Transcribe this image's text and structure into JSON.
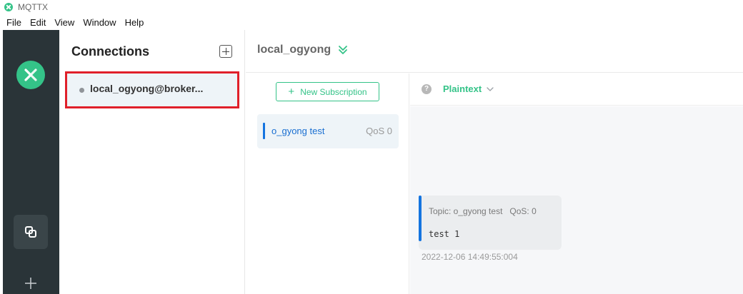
{
  "window": {
    "title": "MQTTX"
  },
  "menu": [
    "File",
    "Edit",
    "View",
    "Window",
    "Help"
  ],
  "connections": {
    "title": "Connections",
    "items": [
      {
        "label": "local_ogyong@broker..."
      }
    ]
  },
  "header": {
    "title": "local_ogyong"
  },
  "subscriptions": {
    "new_label": "New Subscription",
    "items": [
      {
        "topic": "o_gyong test",
        "qos": "QoS 0"
      }
    ]
  },
  "messages": {
    "format": "Plaintext",
    "help_glyph": "?",
    "items": [
      {
        "topic_line": "Topic: o_gyong test",
        "qos": "QoS: 0",
        "payload": "test 1",
        "timestamp": "2022-12-06 14:49:55:004"
      }
    ]
  },
  "colors": {
    "brand": "#34c388",
    "rail": "#2a3438",
    "accent_blue": "#1474e0",
    "highlight_border": "#e0202a"
  }
}
